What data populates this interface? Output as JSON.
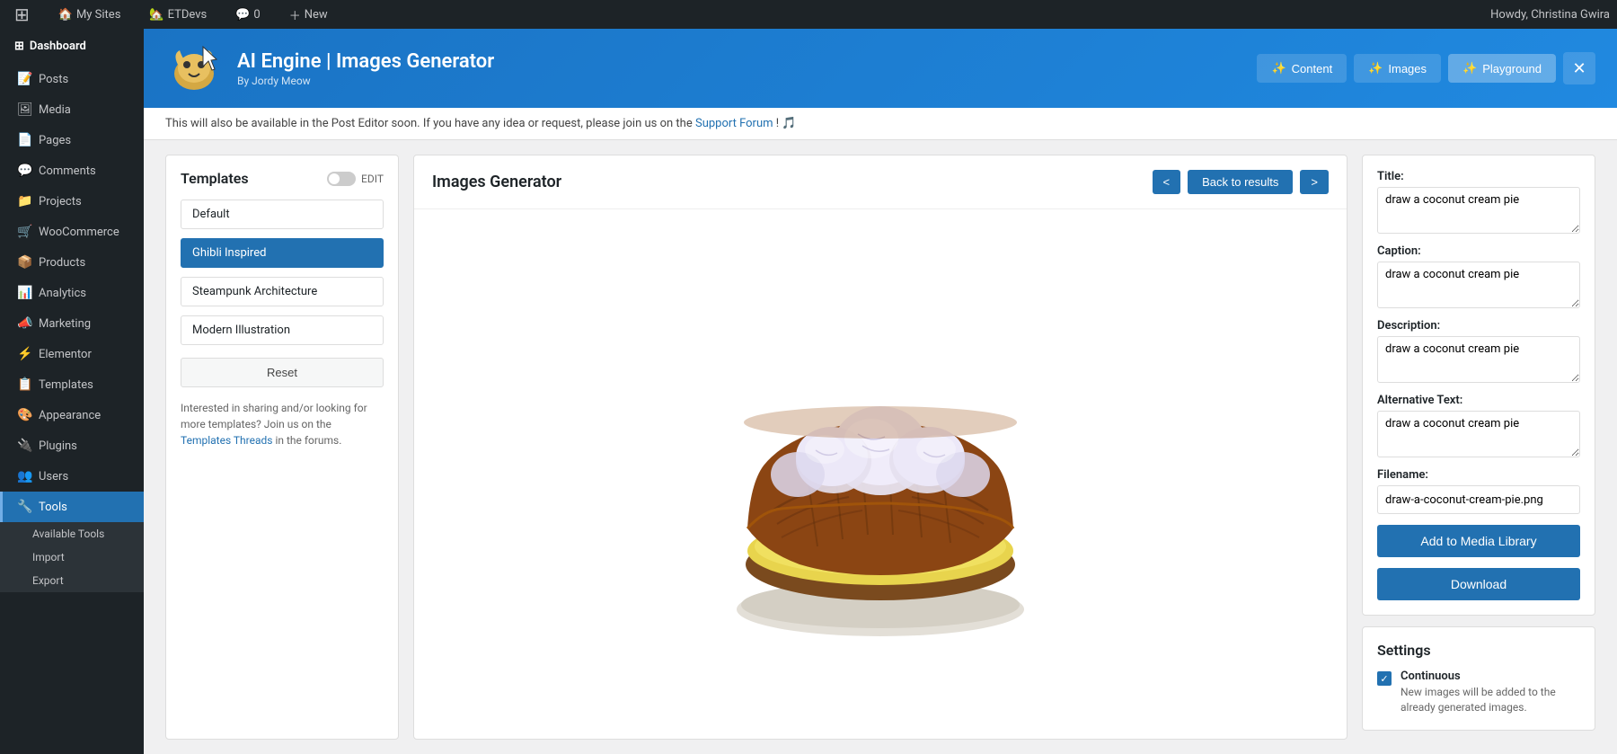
{
  "adminbar": {
    "wp_logo": "⊞",
    "my_sites": "My Sites",
    "site_name": "ETDevs",
    "comments": "0",
    "new": "New",
    "user_greeting": "Howdy, Christina Gwira"
  },
  "sidebar": {
    "dashboard_label": "Dashboard",
    "items": [
      {
        "id": "posts",
        "icon": "📝",
        "label": "Posts"
      },
      {
        "id": "media",
        "icon": "🖼",
        "label": "Media"
      },
      {
        "id": "pages",
        "icon": "📄",
        "label": "Pages"
      },
      {
        "id": "comments",
        "icon": "💬",
        "label": "Comments"
      },
      {
        "id": "projects",
        "icon": "📁",
        "label": "Projects"
      },
      {
        "id": "woocommerce",
        "icon": "🛒",
        "label": "WooCommerce"
      },
      {
        "id": "products",
        "icon": "📦",
        "label": "Products"
      },
      {
        "id": "analytics",
        "icon": "📊",
        "label": "Analytics"
      },
      {
        "id": "marketing",
        "icon": "📣",
        "label": "Marketing"
      },
      {
        "id": "elementor",
        "icon": "⚡",
        "label": "Elementor"
      },
      {
        "id": "templates",
        "icon": "📋",
        "label": "Templates"
      },
      {
        "id": "appearance",
        "icon": "🎨",
        "label": "Appearance"
      },
      {
        "id": "plugins",
        "icon": "🔌",
        "label": "Plugins"
      },
      {
        "id": "users",
        "icon": "👥",
        "label": "Users"
      },
      {
        "id": "tools",
        "icon": "🔧",
        "label": "Tools",
        "active": true
      }
    ],
    "submenu": {
      "parent": "tools",
      "items": [
        {
          "label": "Available Tools",
          "active": false
        },
        {
          "label": "Import",
          "active": false
        },
        {
          "label": "Export",
          "active": false
        }
      ]
    }
  },
  "plugin_header": {
    "title": "AI Engine | Images Generator",
    "author": "By Jordy Meow",
    "nav_buttons": [
      {
        "id": "content",
        "label": "Content",
        "icon": "✨"
      },
      {
        "id": "images",
        "label": "Images",
        "icon": "✨"
      },
      {
        "id": "playground",
        "label": "Playground",
        "icon": "✨",
        "active": true
      }
    ],
    "close_icon": "✕"
  },
  "info_bar": {
    "text": "This will also be available in the Post Editor soon. If you have any idea or request, please join us on the",
    "link_text": "Support Forum",
    "suffix": "! 🎵"
  },
  "templates_panel": {
    "title": "Templates",
    "edit_label": "EDIT",
    "items": [
      {
        "label": "Default",
        "active": false
      },
      {
        "label": "Ghibli Inspired",
        "active": true
      },
      {
        "label": "Steampunk Architecture",
        "active": false
      },
      {
        "label": "Modern Illustration",
        "active": false
      }
    ],
    "reset_label": "Reset",
    "footer_text": "Interested in sharing and/or looking for more templates? Join us on the",
    "footer_link": "Templates Threads",
    "footer_suffix": "in the forums."
  },
  "generator_panel": {
    "title": "Images Generator",
    "nav_prev": "<",
    "nav_back": "Back to results",
    "nav_next": ">"
  },
  "fields_panel": {
    "title_label": "Title:",
    "title_value": "draw a coconut cream pie",
    "caption_label": "Caption:",
    "caption_value": "draw a coconut cream pie",
    "description_label": "Description:",
    "description_value": "draw a coconut cream pie",
    "alt_label": "Alternative Text:",
    "alt_value": "draw a coconut cream pie",
    "filename_label": "Filename:",
    "filename_value": "draw-a-coconut-cream-pie.png",
    "add_to_library_label": "Add to Media Library",
    "download_label": "Download"
  },
  "settings_panel": {
    "title": "Settings",
    "continuous_label": "Continuous",
    "continuous_desc": "New images will be added to the already generated images.",
    "continuous_checked": true
  }
}
